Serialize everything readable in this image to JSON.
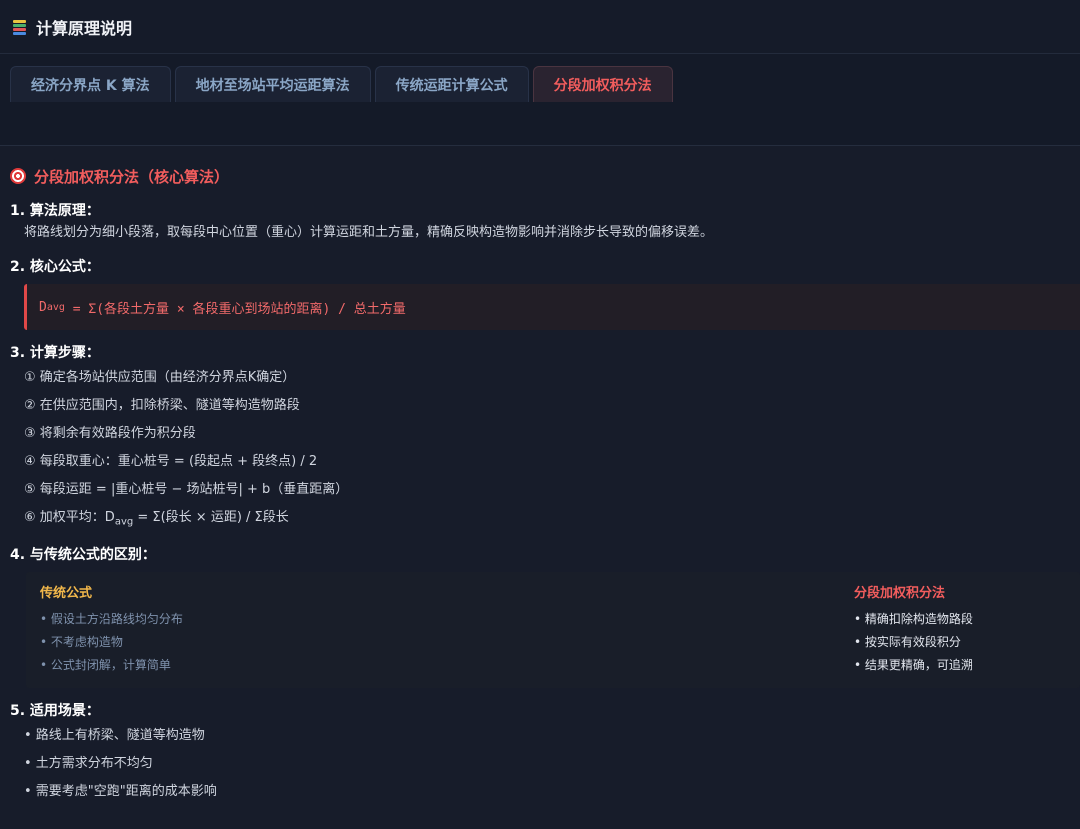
{
  "header": {
    "title": "计算原理说明"
  },
  "tabs": [
    {
      "label": "经济分界点 K 算法"
    },
    {
      "label": "地材至场站平均运距算法"
    },
    {
      "label": "传统运距计算公式"
    },
    {
      "label": "分段加权积分法"
    }
  ],
  "section": {
    "title": "分段加权积分法（核心算法）",
    "h1": "1. 算法原理：",
    "principle": "将路线划分为细小段落，取每段中心位置（重心）计算运距和土方量，精确反映构造物影响并消除步长导致的偏移误差。",
    "h2": "2. 核心公式：",
    "formula_prefix": "D",
    "formula_sub": "avg",
    "formula_rest": " = Σ(各段土方量 × 各段重心到场站的距离) / 总土方量",
    "h3": "3. 计算步骤：",
    "steps": [
      "① 确定各场站供应范围（由经济分界点K确定）",
      "② 在供应范围内，扣除桥梁、隧道等构造物路段",
      "③ 将剩余有效路段作为积分段",
      "④ 每段取重心：重心桩号 = (段起点 + 段终点) / 2",
      "⑤ 每段运距 = |重心桩号 − 场站桩号| + b（垂直距离）"
    ],
    "step6_prefix": "⑥ 加权平均：D",
    "step6_sub": "avg",
    "step6_rest": " = Σ(段长 × 运距) / Σ段长",
    "h4": "4. 与传统公式的区别：",
    "compare": {
      "left_title": "传统公式",
      "left_items": [
        "• 假设土方沿路线均匀分布",
        "• 不考虑构造物",
        "• 公式封闭解，计算简单"
      ],
      "right_title": "分段加权积分法",
      "right_items": [
        "• 精确扣除构造物路段",
        "• 按实际有效段积分",
        "• 结果更精确，可追溯"
      ]
    },
    "h5": "5. 适用场景：",
    "scenarios": [
      "• 路线上有桥梁、隧道等构造物",
      "• 土方需求分布不均匀",
      "• 需要考虑\"空跑\"距离的成本影响"
    ]
  }
}
